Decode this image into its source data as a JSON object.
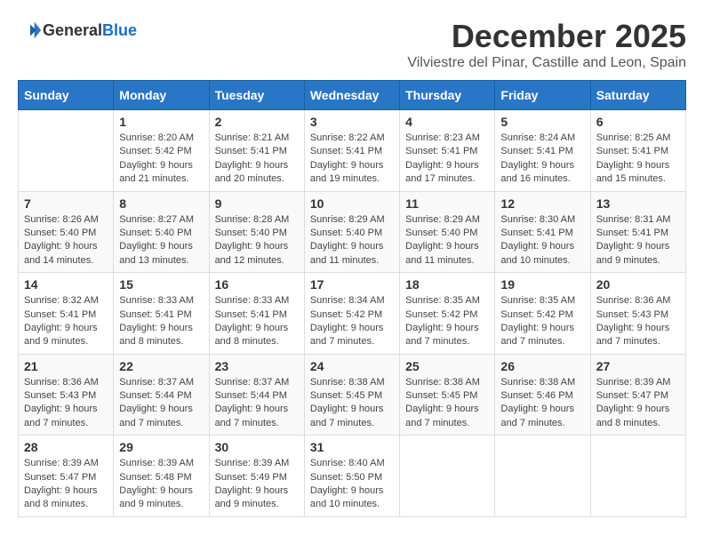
{
  "header": {
    "logo_general": "General",
    "logo_blue": "Blue",
    "month": "December 2025",
    "location": "Vilviestre del Pinar, Castille and Leon, Spain"
  },
  "days_of_week": [
    "Sunday",
    "Monday",
    "Tuesday",
    "Wednesday",
    "Thursday",
    "Friday",
    "Saturday"
  ],
  "weeks": [
    [
      {
        "day": "",
        "info": ""
      },
      {
        "day": "1",
        "info": "Sunrise: 8:20 AM\nSunset: 5:42 PM\nDaylight: 9 hours\nand 21 minutes."
      },
      {
        "day": "2",
        "info": "Sunrise: 8:21 AM\nSunset: 5:41 PM\nDaylight: 9 hours\nand 20 minutes."
      },
      {
        "day": "3",
        "info": "Sunrise: 8:22 AM\nSunset: 5:41 PM\nDaylight: 9 hours\nand 19 minutes."
      },
      {
        "day": "4",
        "info": "Sunrise: 8:23 AM\nSunset: 5:41 PM\nDaylight: 9 hours\nand 17 minutes."
      },
      {
        "day": "5",
        "info": "Sunrise: 8:24 AM\nSunset: 5:41 PM\nDaylight: 9 hours\nand 16 minutes."
      },
      {
        "day": "6",
        "info": "Sunrise: 8:25 AM\nSunset: 5:41 PM\nDaylight: 9 hours\nand 15 minutes."
      }
    ],
    [
      {
        "day": "7",
        "info": "Sunrise: 8:26 AM\nSunset: 5:40 PM\nDaylight: 9 hours\nand 14 minutes."
      },
      {
        "day": "8",
        "info": "Sunrise: 8:27 AM\nSunset: 5:40 PM\nDaylight: 9 hours\nand 13 minutes."
      },
      {
        "day": "9",
        "info": "Sunrise: 8:28 AM\nSunset: 5:40 PM\nDaylight: 9 hours\nand 12 minutes."
      },
      {
        "day": "10",
        "info": "Sunrise: 8:29 AM\nSunset: 5:40 PM\nDaylight: 9 hours\nand 11 minutes."
      },
      {
        "day": "11",
        "info": "Sunrise: 8:29 AM\nSunset: 5:40 PM\nDaylight: 9 hours\nand 11 minutes."
      },
      {
        "day": "12",
        "info": "Sunrise: 8:30 AM\nSunset: 5:41 PM\nDaylight: 9 hours\nand 10 minutes."
      },
      {
        "day": "13",
        "info": "Sunrise: 8:31 AM\nSunset: 5:41 PM\nDaylight: 9 hours\nand 9 minutes."
      }
    ],
    [
      {
        "day": "14",
        "info": "Sunrise: 8:32 AM\nSunset: 5:41 PM\nDaylight: 9 hours\nand 9 minutes."
      },
      {
        "day": "15",
        "info": "Sunrise: 8:33 AM\nSunset: 5:41 PM\nDaylight: 9 hours\nand 8 minutes."
      },
      {
        "day": "16",
        "info": "Sunrise: 8:33 AM\nSunset: 5:41 PM\nDaylight: 9 hours\nand 8 minutes."
      },
      {
        "day": "17",
        "info": "Sunrise: 8:34 AM\nSunset: 5:42 PM\nDaylight: 9 hours\nand 7 minutes."
      },
      {
        "day": "18",
        "info": "Sunrise: 8:35 AM\nSunset: 5:42 PM\nDaylight: 9 hours\nand 7 minutes."
      },
      {
        "day": "19",
        "info": "Sunrise: 8:35 AM\nSunset: 5:42 PM\nDaylight: 9 hours\nand 7 minutes."
      },
      {
        "day": "20",
        "info": "Sunrise: 8:36 AM\nSunset: 5:43 PM\nDaylight: 9 hours\nand 7 minutes."
      }
    ],
    [
      {
        "day": "21",
        "info": "Sunrise: 8:36 AM\nSunset: 5:43 PM\nDaylight: 9 hours\nand 7 minutes."
      },
      {
        "day": "22",
        "info": "Sunrise: 8:37 AM\nSunset: 5:44 PM\nDaylight: 9 hours\nand 7 minutes."
      },
      {
        "day": "23",
        "info": "Sunrise: 8:37 AM\nSunset: 5:44 PM\nDaylight: 9 hours\nand 7 minutes."
      },
      {
        "day": "24",
        "info": "Sunrise: 8:38 AM\nSunset: 5:45 PM\nDaylight: 9 hours\nand 7 minutes."
      },
      {
        "day": "25",
        "info": "Sunrise: 8:38 AM\nSunset: 5:45 PM\nDaylight: 9 hours\nand 7 minutes."
      },
      {
        "day": "26",
        "info": "Sunrise: 8:38 AM\nSunset: 5:46 PM\nDaylight: 9 hours\nand 7 minutes."
      },
      {
        "day": "27",
        "info": "Sunrise: 8:39 AM\nSunset: 5:47 PM\nDaylight: 9 hours\nand 8 minutes."
      }
    ],
    [
      {
        "day": "28",
        "info": "Sunrise: 8:39 AM\nSunset: 5:47 PM\nDaylight: 9 hours\nand 8 minutes."
      },
      {
        "day": "29",
        "info": "Sunrise: 8:39 AM\nSunset: 5:48 PM\nDaylight: 9 hours\nand 9 minutes."
      },
      {
        "day": "30",
        "info": "Sunrise: 8:39 AM\nSunset: 5:49 PM\nDaylight: 9 hours\nand 9 minutes."
      },
      {
        "day": "31",
        "info": "Sunrise: 8:40 AM\nSunset: 5:50 PM\nDaylight: 9 hours\nand 10 minutes."
      },
      {
        "day": "",
        "info": ""
      },
      {
        "day": "",
        "info": ""
      },
      {
        "day": "",
        "info": ""
      }
    ]
  ]
}
